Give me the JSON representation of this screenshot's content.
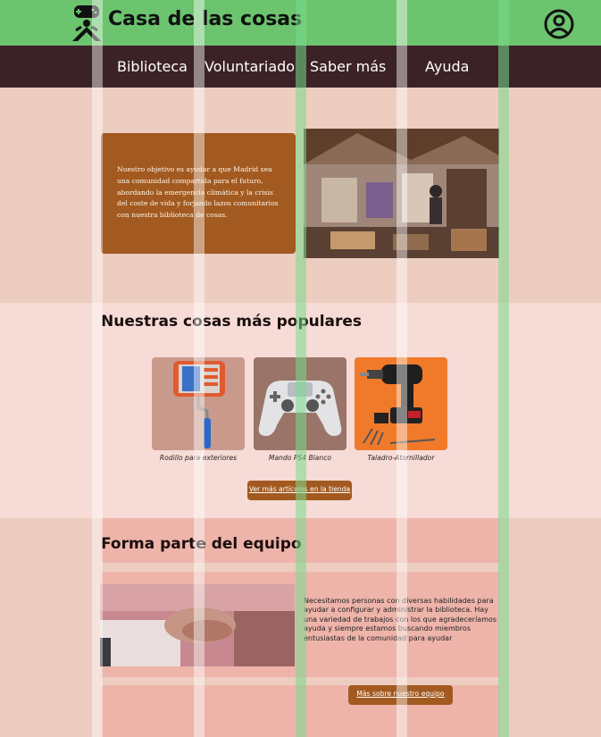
{
  "header": {
    "title": "Casa de las cosas",
    "logo_icon": "gamepad-person-icon",
    "account_icon": "user-circle-icon"
  },
  "nav": {
    "items": [
      {
        "label": "Biblioteca"
      },
      {
        "label": "Voluntariado"
      },
      {
        "label": "Saber más"
      },
      {
        "label": "Ayuda"
      }
    ]
  },
  "hero": {
    "text": "Nuestro objetivo es ayudar a que Madrid sea una comunidad compartida para el futuro, abordando la emergencia climática y la crisis del coste de vida y forjando lazos comunitarios con nuestra biblioteca de cosas."
  },
  "popular": {
    "title": "Nuestras cosas más populares",
    "products": [
      {
        "caption": "Rodillo para exteriores"
      },
      {
        "caption": "Mando PS4 Blanco"
      },
      {
        "caption": "Taladro-Atornillador"
      }
    ],
    "button_label": "Ver más artículos en la tienda"
  },
  "team": {
    "title": "Forma parte del equipo",
    "text": "Necesitamos personas con diversas habilidades para ayudar a configurar y administrar la biblioteca. Hay una variedad de trabajos con los que agradeceríamos ayuda y siempre estamos buscando miembros entusiastas de la comunidad para ayudar",
    "button_label": "Más sobre nuestro equipo"
  },
  "colors": {
    "header_green": "#6cc46e",
    "nav_dark": "#3b2227",
    "accent_brown": "#a25a20",
    "page_bg": "#edcdbf"
  }
}
